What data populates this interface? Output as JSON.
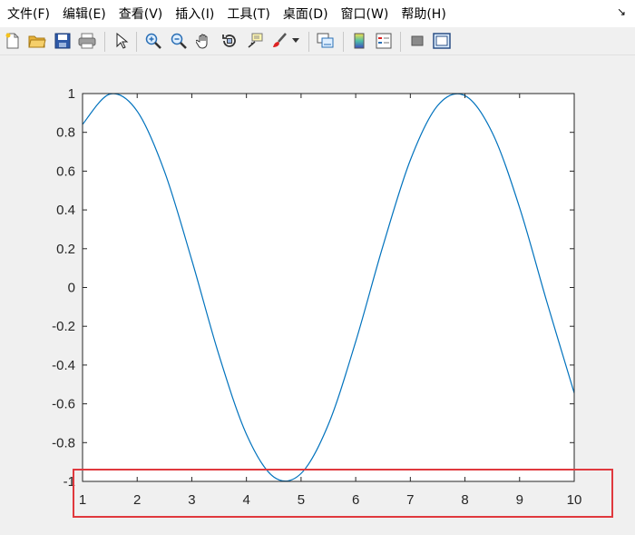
{
  "menubar": {
    "items": [
      "文件(F)",
      "编辑(E)",
      "查看(V)",
      "插入(I)",
      "工具(T)",
      "桌面(D)",
      "窗口(W)",
      "帮助(H)"
    ],
    "corner": "↘"
  },
  "toolbar": {
    "icons": [
      "new-file-icon",
      "open-folder-icon",
      "save-icon",
      "print-icon",
      "pointer-icon",
      "zoom-in-icon",
      "zoom-out-icon",
      "pan-hand-icon",
      "rotate-3d-icon",
      "data-cursor-icon",
      "brush-icon",
      "brush-dropdown-icon",
      "link-plot-icon",
      "colorbar-icon",
      "legend-icon",
      "hide-plot-tools-icon",
      "show-plot-tools-icon"
    ]
  },
  "chart_data": {
    "type": "line",
    "function": "sin(x)",
    "xlim": [
      1,
      10
    ],
    "ylim": [
      -1,
      1
    ],
    "x_ticks": [
      "1",
      "2",
      "3",
      "4",
      "5",
      "6",
      "7",
      "8",
      "9",
      "10"
    ],
    "y_ticks": [
      "1",
      "0.8",
      "0.6",
      "0.4",
      "0.2",
      "0",
      "-0.2",
      "-0.4",
      "-0.6",
      "-0.8",
      "-1"
    ],
    "series": [
      {
        "color": "#0072bd",
        "x": [
          1,
          1.5,
          2,
          2.5,
          3,
          3.5,
          4,
          4.5,
          5,
          5.5,
          6,
          6.5,
          7,
          7.5,
          8,
          8.5,
          9,
          9.5,
          10
        ],
        "y": [
          0.841,
          0.997,
          0.909,
          0.598,
          0.141,
          -0.351,
          -0.757,
          -0.977,
          -0.959,
          -0.706,
          -0.279,
          0.215,
          0.657,
          0.938,
          0.989,
          0.798,
          0.412,
          -0.075,
          -0.544
        ]
      }
    ],
    "grid": false,
    "box": true
  },
  "annotation": {
    "highlight_color": "#e0393e"
  }
}
